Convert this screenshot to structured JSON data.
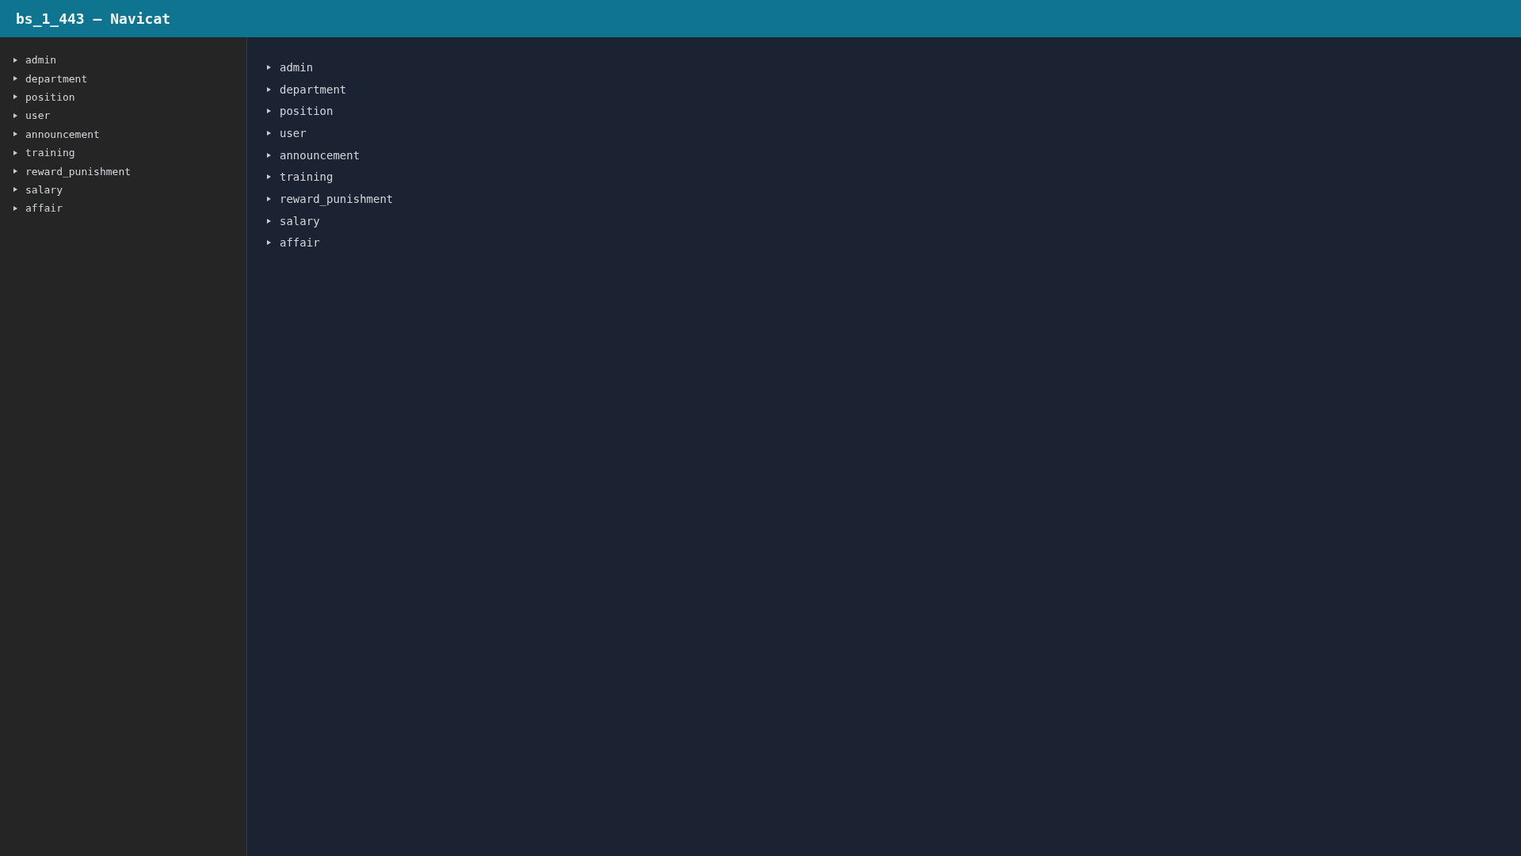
{
  "window": {
    "title": "bs_1_443 — Navicat"
  },
  "sidebar": {
    "items": [
      {
        "label": "admin",
        "expanded": false
      },
      {
        "label": "department",
        "expanded": false
      },
      {
        "label": "position",
        "expanded": false
      },
      {
        "label": "user",
        "expanded": false
      },
      {
        "label": "announcement",
        "expanded": false
      },
      {
        "label": "training",
        "expanded": false
      },
      {
        "label": "reward_punishment",
        "expanded": false
      },
      {
        "label": "salary",
        "expanded": false
      },
      {
        "label": "affair",
        "expanded": false
      }
    ]
  },
  "main": {
    "items": [
      {
        "label": "admin",
        "expanded": false
      },
      {
        "label": "department",
        "expanded": false
      },
      {
        "label": "position",
        "expanded": false
      },
      {
        "label": "user",
        "expanded": false
      },
      {
        "label": "announcement",
        "expanded": false
      },
      {
        "label": "training",
        "expanded": false
      },
      {
        "label": "reward_punishment",
        "expanded": false
      },
      {
        "label": "salary",
        "expanded": false
      },
      {
        "label": "affair",
        "expanded": false
      }
    ]
  }
}
